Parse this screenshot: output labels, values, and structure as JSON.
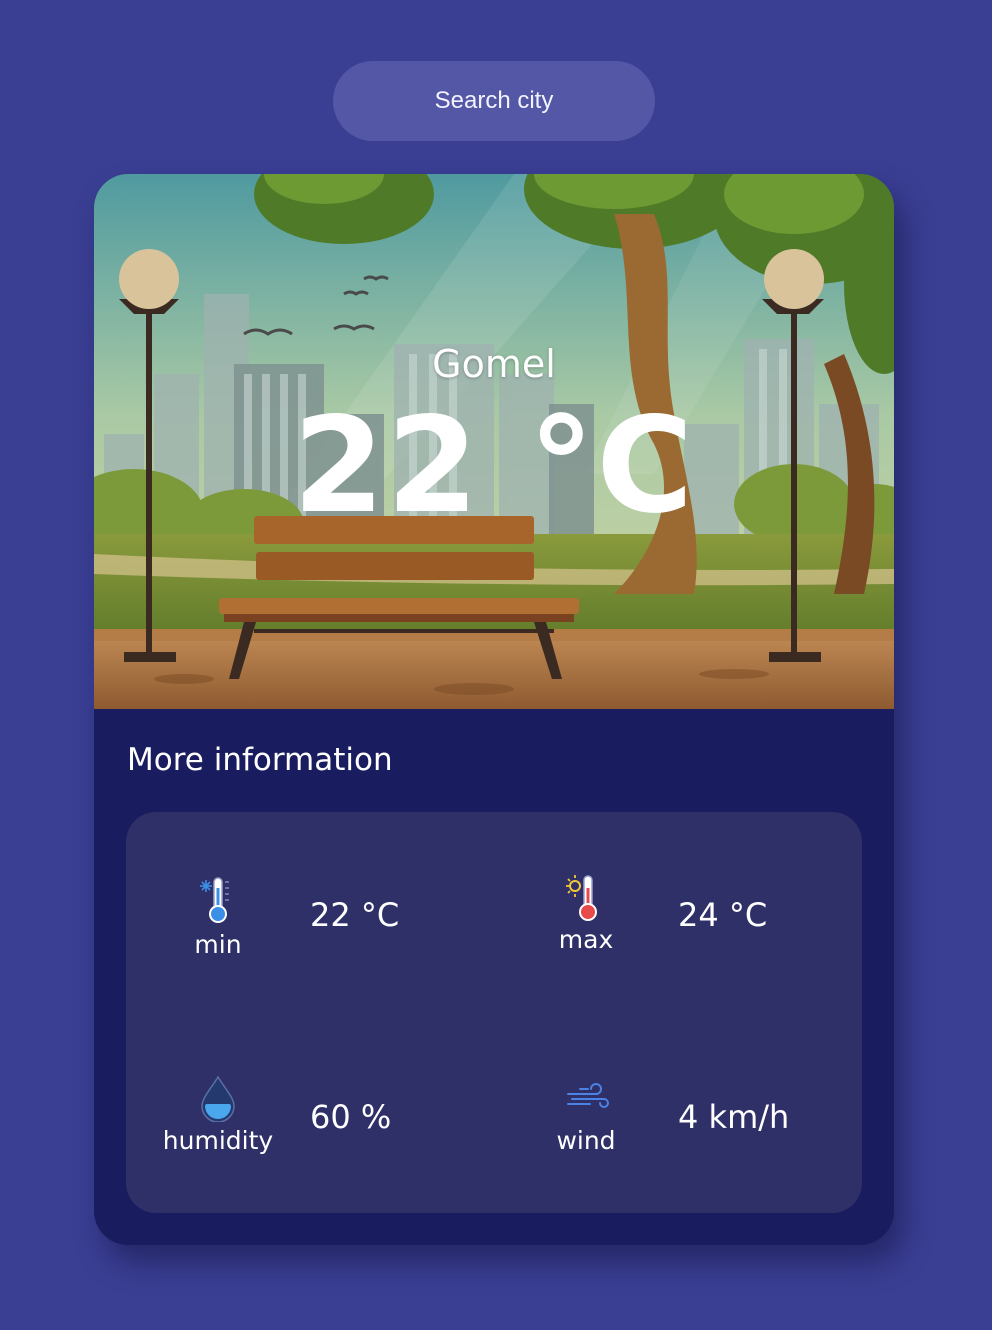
{
  "search": {
    "placeholder": "Search city"
  },
  "weather": {
    "city": "Gomel",
    "temperature": "22 °C"
  },
  "details": {
    "title": "More information",
    "min": {
      "label": "min",
      "value": "22 °C",
      "icon": "thermometer-cold-icon"
    },
    "max": {
      "label": "max",
      "value": "24 °C",
      "icon": "thermometer-hot-icon"
    },
    "humidity": {
      "label": "humidity",
      "value": "60 %",
      "icon": "water-drop-icon"
    },
    "wind": {
      "label": "wind",
      "value": "4 km/h",
      "icon": "wind-icon"
    }
  },
  "colors": {
    "background": "#3b3f94",
    "search_bg": "#5357a6",
    "card_bg": "#191c5e",
    "panel_bg": "#2f3068",
    "text": "#ffffff"
  }
}
